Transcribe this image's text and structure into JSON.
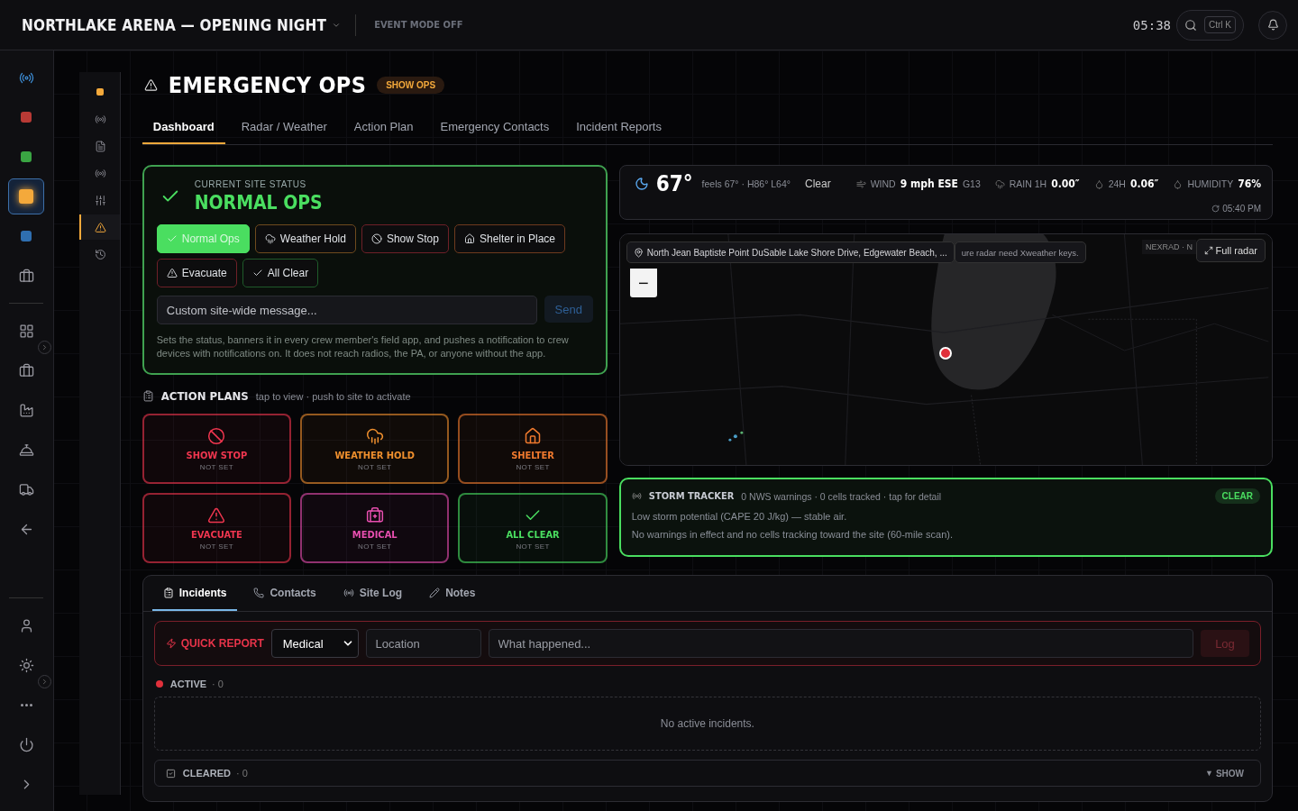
{
  "topbar": {
    "event": "NORTHLAKE ARENA — OPENING NIGHT",
    "mode": "EVENT MODE OFF",
    "clock": "05:38",
    "shortcut": "Ctrl K"
  },
  "rail": {
    "top": [
      {
        "kind": "radio",
        "selected": false
      },
      {
        "kind": "square",
        "color": "#b83a35",
        "selected": false
      },
      {
        "kind": "square",
        "color": "#3aa543",
        "selected": false
      },
      {
        "kind": "square",
        "color": "#f4a93b",
        "selected": true
      },
      {
        "kind": "square",
        "color": "#2f6fb0",
        "selected": false
      },
      {
        "kind": "briefcase",
        "selected": false
      }
    ],
    "middle": [
      {
        "kind": "grid",
        "selected": false
      },
      {
        "kind": "briefcase",
        "selected": false
      },
      {
        "kind": "factory",
        "selected": false
      },
      {
        "kind": "cloche",
        "selected": false
      },
      {
        "kind": "truck",
        "selected": false
      },
      {
        "kind": "back",
        "selected": false
      }
    ],
    "bottom": [
      {
        "kind": "user",
        "selected": false
      },
      {
        "kind": "sun",
        "selected": false
      },
      {
        "kind": "more",
        "selected": false
      },
      {
        "kind": "power",
        "selected": false
      },
      {
        "kind": "chevron",
        "selected": false
      }
    ]
  },
  "subrail": [
    {
      "kind": "dot",
      "selected": false
    },
    {
      "kind": "radio",
      "selected": false
    },
    {
      "kind": "file",
      "selected": false
    },
    {
      "kind": "radio",
      "selected": false
    },
    {
      "kind": "sliders",
      "selected": false
    },
    {
      "kind": "alert",
      "selected": true
    },
    {
      "kind": "history",
      "selected": false
    }
  ],
  "page": {
    "title": "EMERGENCY OPS",
    "badge": "SHOW OPS"
  },
  "tabs": [
    {
      "label": "Dashboard",
      "selected": true
    },
    {
      "label": "Radar / Weather",
      "selected": false
    },
    {
      "label": "Action Plan",
      "selected": false
    },
    {
      "label": "Emergency Contacts",
      "selected": false
    },
    {
      "label": "Incident Reports",
      "selected": false
    }
  ],
  "site_status": {
    "caption": "CURRENT SITE STATUS",
    "value": "NORMAL OPS",
    "options": [
      {
        "label": "Normal Ops",
        "kind": "check",
        "color": "#4ade60",
        "selected": true
      },
      {
        "label": "Weather Hold",
        "kind": "rain",
        "color": "#6e4a1e",
        "selected": false
      },
      {
        "label": "Show Stop",
        "kind": "ban",
        "color": "#6e2028",
        "selected": false
      },
      {
        "label": "Shelter in Place",
        "kind": "home",
        "color": "#6e3a1e",
        "selected": false
      },
      {
        "label": "Evacuate",
        "kind": "alert",
        "color": "#6e2028",
        "selected": false
      },
      {
        "label": "All Clear",
        "kind": "check",
        "color": "#1f5a2a",
        "selected": false
      }
    ],
    "message_placeholder": "Custom site-wide message...",
    "send": "Send",
    "note": "Sets the status, banners it in every crew member's field app, and pushes a notification to crew devices with notifications on. It does not reach radios, the PA, or anyone without the app."
  },
  "action_plans": {
    "title": "ACTION PLANS",
    "hint": "tap to view · push to site to activate",
    "plans": [
      {
        "title": "SHOW STOP",
        "status": "NOT SET",
        "kind": "ban",
        "color": "#f0364f"
      },
      {
        "title": "WEATHER HOLD",
        "status": "NOT SET",
        "kind": "rain",
        "color": "#f0902e"
      },
      {
        "title": "SHELTER",
        "status": "NOT SET",
        "kind": "home",
        "color": "#f07a2e"
      },
      {
        "title": "EVACUATE",
        "status": "NOT SET",
        "kind": "alert",
        "color": "#f0364f"
      },
      {
        "title": "MEDICAL",
        "status": "NOT SET",
        "kind": "medical",
        "color": "#e84fb0"
      },
      {
        "title": "ALL CLEAR",
        "status": "NOT SET",
        "kind": "check",
        "color": "#4ade60"
      }
    ]
  },
  "weather": {
    "temp": "67°",
    "feels": "feels 67° · H86° L64°",
    "condition": "Clear",
    "stats": [
      {
        "kind": "wind",
        "label": "WIND",
        "value": "9 mph ESE",
        "extra": "G13"
      },
      {
        "kind": "rain",
        "label": "RAIN 1H",
        "value": "0.00″"
      },
      {
        "kind": "drop",
        "label": "24H",
        "value": "0.06″"
      },
      {
        "kind": "drop",
        "label": "HUMIDITY",
        "value": "76%"
      }
    ],
    "updated": "05:40 PM"
  },
  "map": {
    "address": "North Jean Baptiste Point DuSable Lake Shore Drive, Edgewater Beach, ...",
    "note": "ure radar need Xweather keys.",
    "source": "NEXRAD · N",
    "full_radar": "Full radar",
    "zoom_out": "−"
  },
  "storm_tracker": {
    "title": "STORM TRACKER",
    "summary": "0 NWS warnings · 0 cells tracked · tap for detail",
    "badge": "CLEAR",
    "lines": [
      "Low storm potential (CAPE 20 J/kg) — stable air.",
      "No warnings in effect and no cells tracking toward the site (60-mile scan)."
    ]
  },
  "incidents": {
    "tabs": [
      {
        "label": "Incidents",
        "kind": "clipboard",
        "selected": true
      },
      {
        "label": "Contacts",
        "kind": "phone",
        "selected": false
      },
      {
        "label": "Site Log",
        "kind": "radio",
        "selected": false
      },
      {
        "label": "Notes",
        "kind": "pen",
        "selected": false
      }
    ],
    "quick_report": {
      "label": "QUICK REPORT",
      "type": "Medical",
      "location_placeholder": "Location",
      "what_placeholder": "What happened...",
      "button": "Log"
    },
    "active": {
      "label": "ACTIVE",
      "count": "· 0",
      "empty": "No active incidents."
    },
    "cleared": {
      "label": "CLEARED",
      "count": "· 0",
      "toggle_icon": "▼",
      "toggle": "SHOW"
    }
  }
}
